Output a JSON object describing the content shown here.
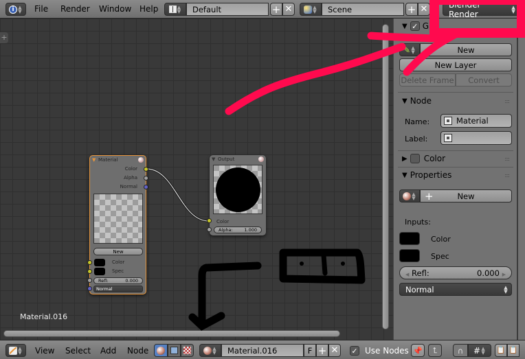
{
  "topbar": {
    "menus": [
      "File",
      "Render",
      "Window",
      "Help"
    ],
    "screen_layout": "Default",
    "scene": "Scene",
    "render_engine": "Blender Render",
    "icons": {
      "info": "info-icon",
      "layout": "layout-icon",
      "scene": "scene-icon"
    }
  },
  "sidebar": {
    "grease_pencil": {
      "header": "Gr",
      "enabled": true,
      "new_label": "New",
      "new_layer_label": "New Layer",
      "delete_frame_label": "Delete Frame",
      "convert_label": "Convert"
    },
    "node_panel": {
      "header": "Node",
      "name_label": "Name:",
      "name_value": "Material",
      "label_label": "Label:",
      "label_value": ""
    },
    "color_panel": {
      "header": "Color",
      "enabled": false
    },
    "properties_panel": {
      "header": "Properties",
      "new_label": "New",
      "inputs_label": "Inputs:",
      "inputs": [
        {
          "label": "Color",
          "swatch": "#000000"
        },
        {
          "label": "Spec",
          "swatch": "#000000"
        }
      ],
      "refl_label": "Refl:",
      "refl_value": "0.000",
      "normal_select": "Normal"
    }
  },
  "canvas": {
    "material_name": "Material.016",
    "material_node": {
      "title": "Material",
      "outputs": [
        "Color",
        "Alpha",
        "Normal"
      ],
      "new_label": "New",
      "inputs": [
        "Color",
        "Spec"
      ],
      "refl_label": "Refl:",
      "refl_value": "0.000",
      "normal_select": "Normal"
    },
    "output_node": {
      "title": "Output",
      "input_color": "Color",
      "alpha_label": "Alpha:",
      "alpha_value": "1.000"
    }
  },
  "bottombar": {
    "menus": [
      "View",
      "Select",
      "Add",
      "Node"
    ],
    "material_field": "Material.016",
    "fake_user": "F",
    "use_nodes_label": "Use Nodes",
    "use_nodes_checked": true
  },
  "colors": {
    "annotation_red": "#ff0a4e",
    "annotation_black": "#000000",
    "socket_yellow": "#c7c729",
    "socket_gray": "#a1a1a1",
    "socket_blue": "#6363c7",
    "node_selected_border": "#e8953a"
  }
}
